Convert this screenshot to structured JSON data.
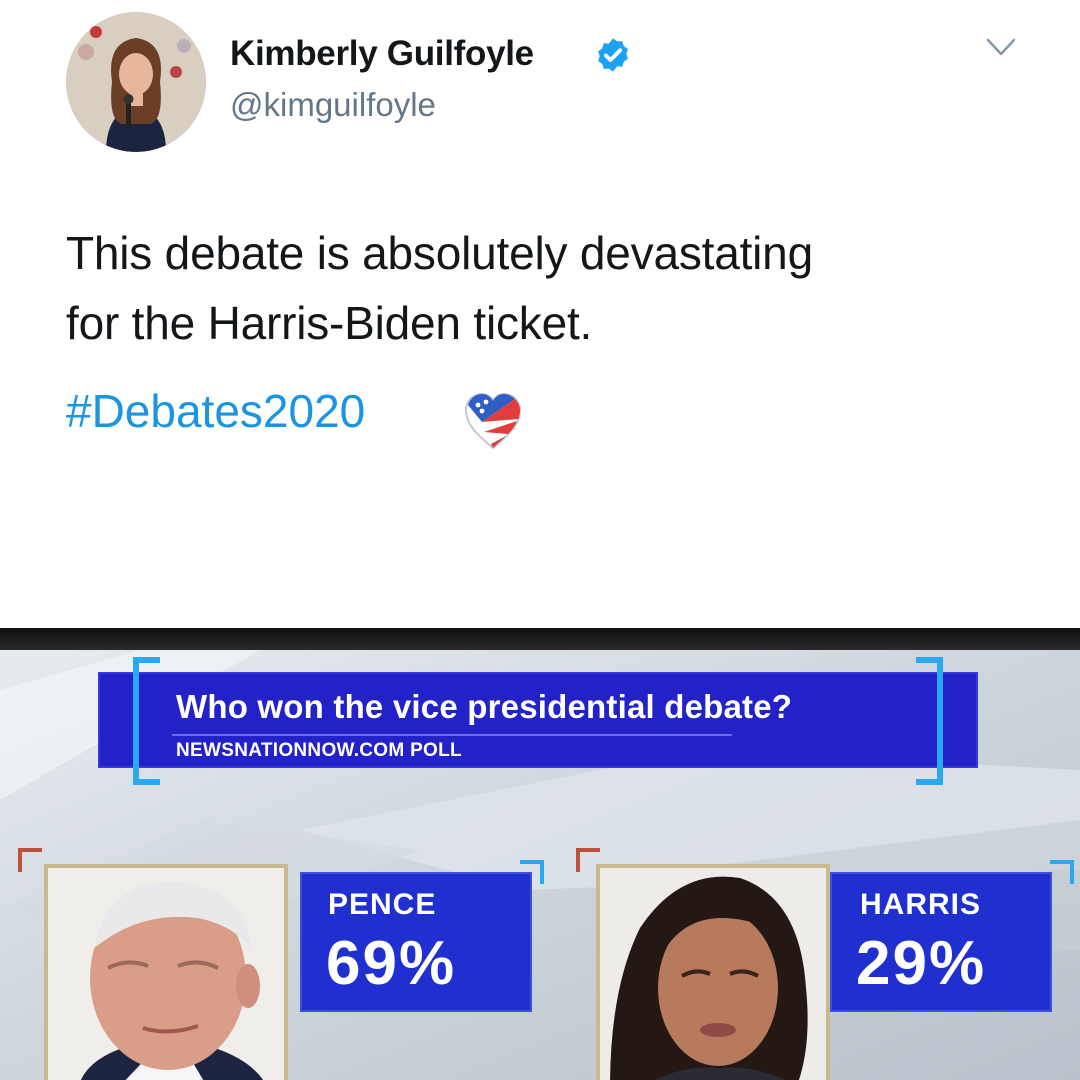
{
  "tweet": {
    "author": {
      "display_name": "Kimberly Guilfoyle",
      "handle": "@kimguilfoyle",
      "verified": true,
      "verified_icon": "verified-badge-icon"
    },
    "menu_icon": "chevron-down-icon",
    "text_lines": [
      "This debate is absolutely devastating",
      "for the Harris-Biden ticket."
    ],
    "hashtag": "#Debates2020",
    "hashflag_icon": "heart-flag-icon",
    "colors": {
      "link": "#1b95e0",
      "verified": "#1da1f2",
      "secondary_text": "#657786"
    }
  },
  "tv_graphic": {
    "question": "Who won the vice presidential debate?",
    "source": "NEWSNATIONNOW.COM POLL",
    "candidates": [
      {
        "name": "PENCE",
        "percent": "69%",
        "value": 69
      },
      {
        "name": "HARRIS",
        "percent": "29%",
        "value": 29
      }
    ],
    "colors": {
      "panel": "#2222c8",
      "accent_bracket": "#2aa8f0",
      "frame": "#c9b98e"
    }
  }
}
